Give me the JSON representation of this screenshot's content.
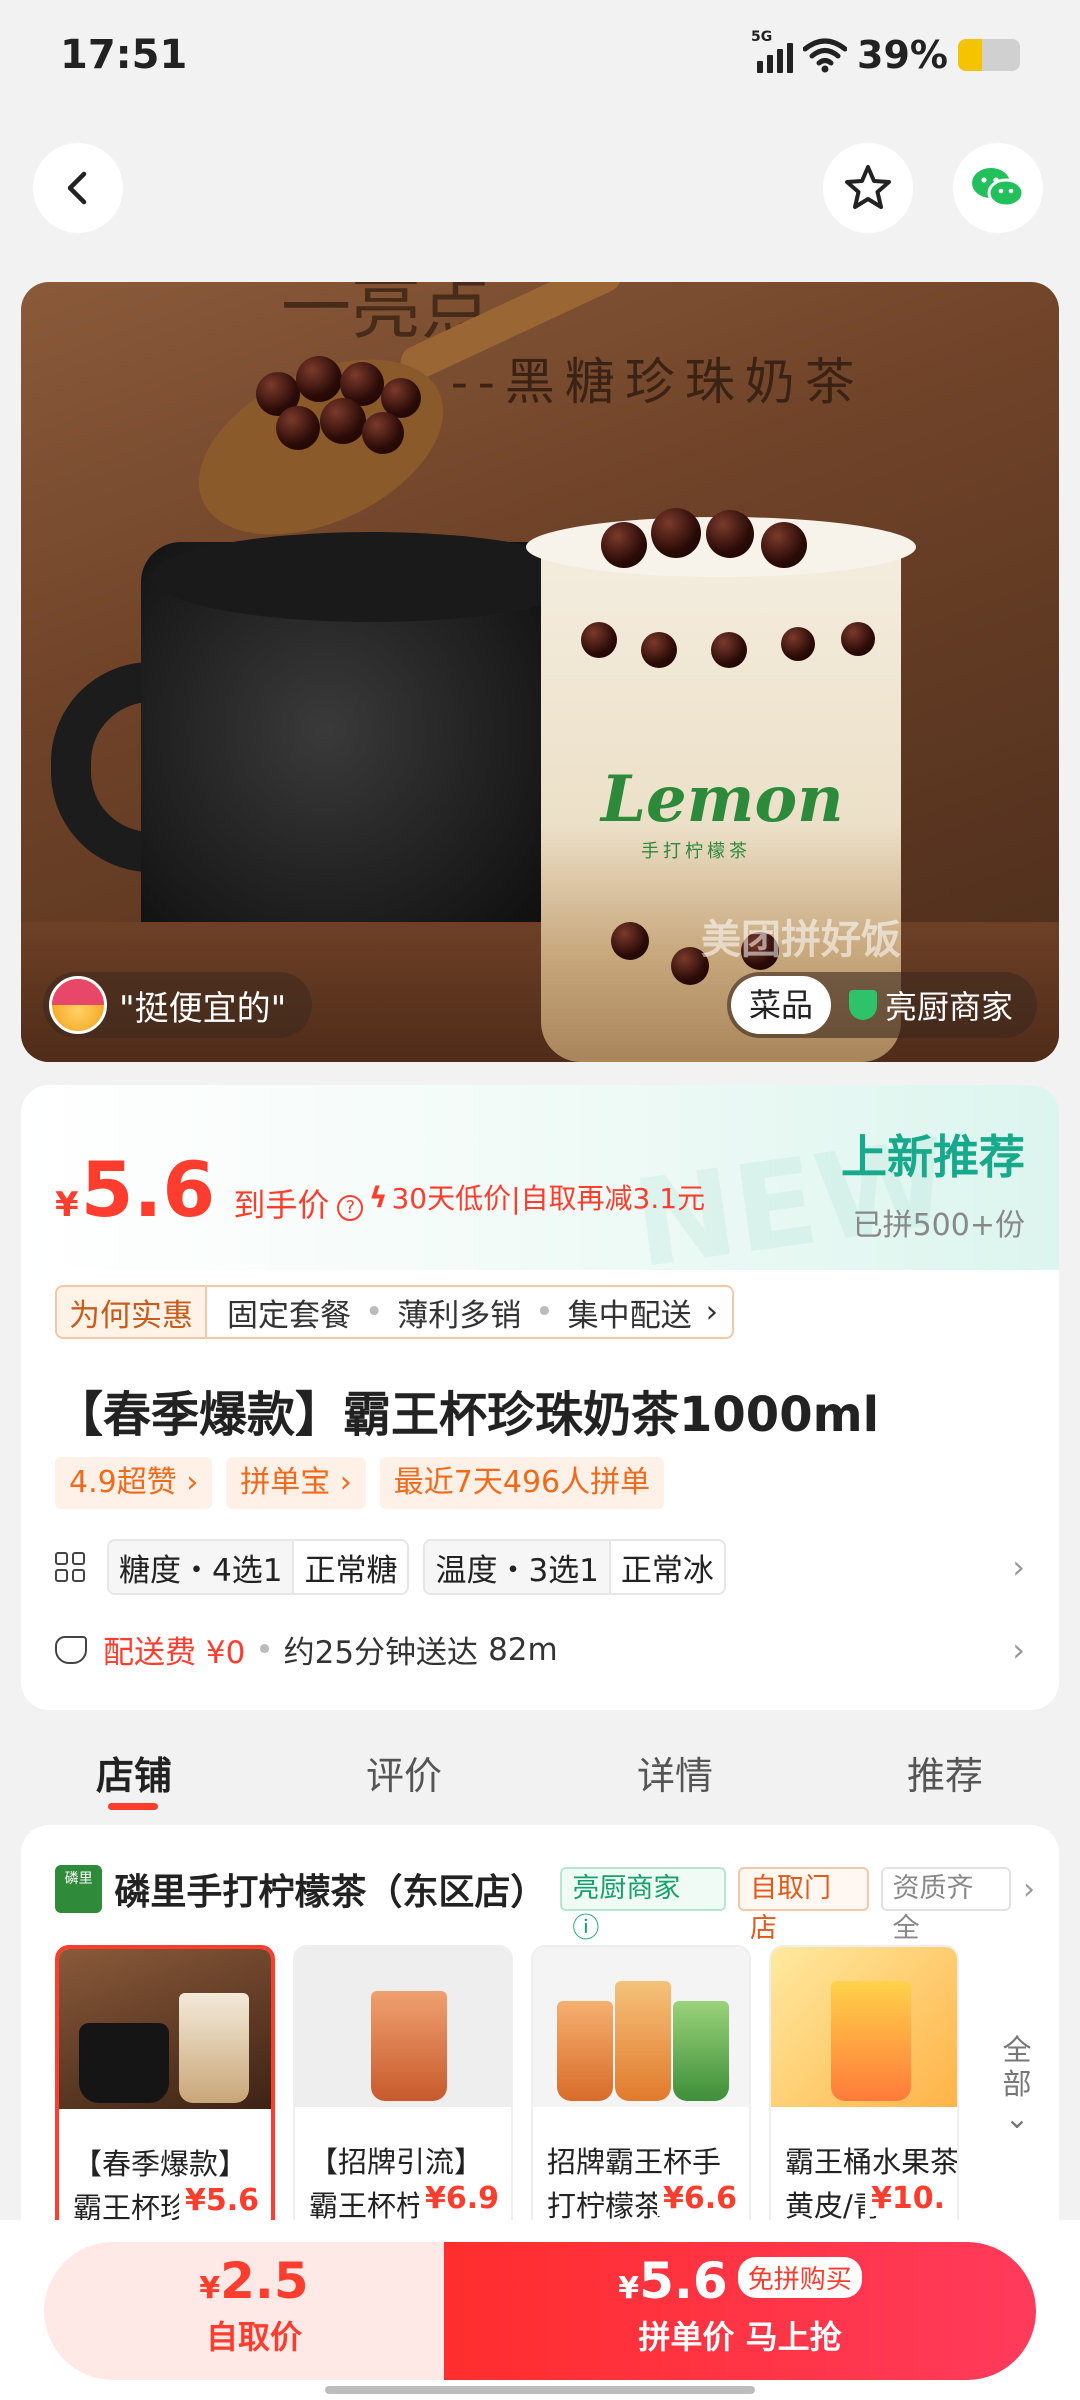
{
  "status": {
    "time": "17:51",
    "network": "5G",
    "battery": "39%",
    "battery_level": 0.39
  },
  "nav": {
    "back_icon": "chevron-left-icon",
    "fav_icon": "star-icon",
    "share_icon": "wechat-icon"
  },
  "hero": {
    "caption": "--黑糖珍珠奶茶",
    "cup_brand": "Lemon",
    "cup_brand_sub": "手打柠檬茶",
    "watermark": "美团拼好饭",
    "quote": "\"挺便宜的\"",
    "tag_dish": "菜品",
    "tag_chef": "亮厨商家"
  },
  "product": {
    "currency": "¥",
    "price": "5.6",
    "price_label": "到手价",
    "promo": "30天低价|自取再减3.1元",
    "new_title": "上新推荐",
    "new_sub": "已拼500+份",
    "why_label": "为何实惠",
    "why_items": [
      "固定套餐",
      "薄利多销",
      "集中配送"
    ],
    "title": "【春季爆款】霸王杯珍珠奶茶1000ml",
    "badges": [
      "4.9超赞 ›",
      "拼单宝 ›",
      "最近7天496人拼单"
    ],
    "options": [
      {
        "label": "糖度・4选1",
        "value": "正常糖"
      },
      {
        "label": "温度・3选1",
        "value": "正常冰"
      }
    ],
    "delivery_fee": "配送费 ¥0",
    "delivery_time": "约25分钟送达",
    "distance": "82m"
  },
  "tabs": [
    "店铺",
    "评价",
    "详情",
    "推荐"
  ],
  "store": {
    "logo_text": "磷里",
    "name": "磷里手打柠檬茶（东区店）",
    "tags": [
      "亮厨商家",
      "自取门店",
      "资质齐全"
    ],
    "items": [
      {
        "line1": "【春季爆款】",
        "line2": "霸王杯珍",
        "price": "¥5.6"
      },
      {
        "line1": "【招牌引流】",
        "line2": "霸王杯柠",
        "price": "¥6.9"
      },
      {
        "line1": "招牌霸王杯手",
        "line2": "打柠檬茶",
        "price": "¥6.6"
      },
      {
        "line1": "霸王桶水果茶",
        "line2": "黄皮/青",
        "price": "¥10."
      }
    ],
    "more": "全部"
  },
  "bottom": {
    "pickup_price": "2.5",
    "pickup_label": "自取价",
    "group_price": "5.6",
    "group_badge": "免拼购买",
    "group_label": "拼单价 马上抢"
  }
}
